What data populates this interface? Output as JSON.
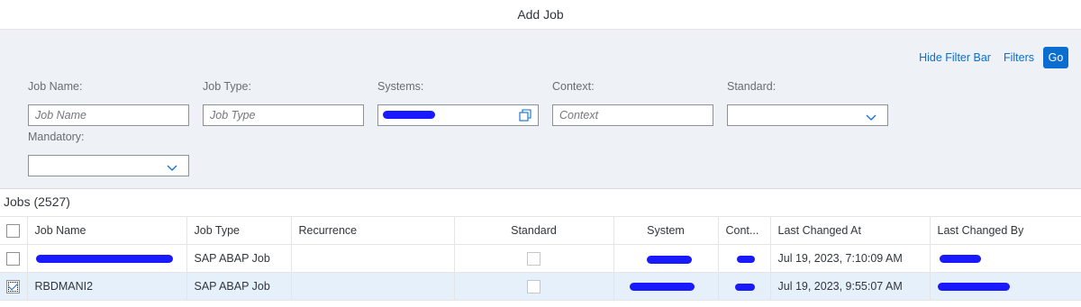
{
  "title": "Add Job",
  "filter_bar": {
    "hide_filter_bar": "Hide Filter Bar",
    "filters": "Filters",
    "go": "Go",
    "fields": {
      "job_name": {
        "label": "Job Name:",
        "placeholder": "Job Name"
      },
      "job_type": {
        "label": "Job Type:",
        "placeholder": "Job Type"
      },
      "systems": {
        "label": "Systems:"
      },
      "context": {
        "label": "Context:",
        "placeholder": "Context"
      },
      "standard": {
        "label": "Standard:"
      },
      "mandatory": {
        "label": "Mandatory:"
      }
    }
  },
  "table": {
    "title": "Jobs (2527)",
    "columns": [
      "Job Name",
      "Job Type",
      "Recurrence",
      "Standard",
      "System",
      "Cont...",
      "Last Changed At",
      "Last Changed By"
    ],
    "rows": [
      {
        "job_name": "",
        "job_type": "SAP ABAP Job",
        "recurrence": "",
        "standard": false,
        "last_changed_at": "Jul 19, 2023, 7:10:09 AM",
        "selected": false
      },
      {
        "job_name": "RBDMANI2",
        "job_type": "SAP ABAP Job",
        "recurrence": "",
        "standard": false,
        "last_changed_at": "Jul 19, 2023, 9:55:07 AM",
        "selected": true
      }
    ]
  },
  "colors": {
    "accent": "#0a6ed1",
    "filter_bg": "#eef2f6",
    "selected_row": "#e5f0fa",
    "redaction": "#1a1aff"
  },
  "icons": [
    "value-help-icon",
    "chevron-down-icon",
    "checkbox"
  ]
}
